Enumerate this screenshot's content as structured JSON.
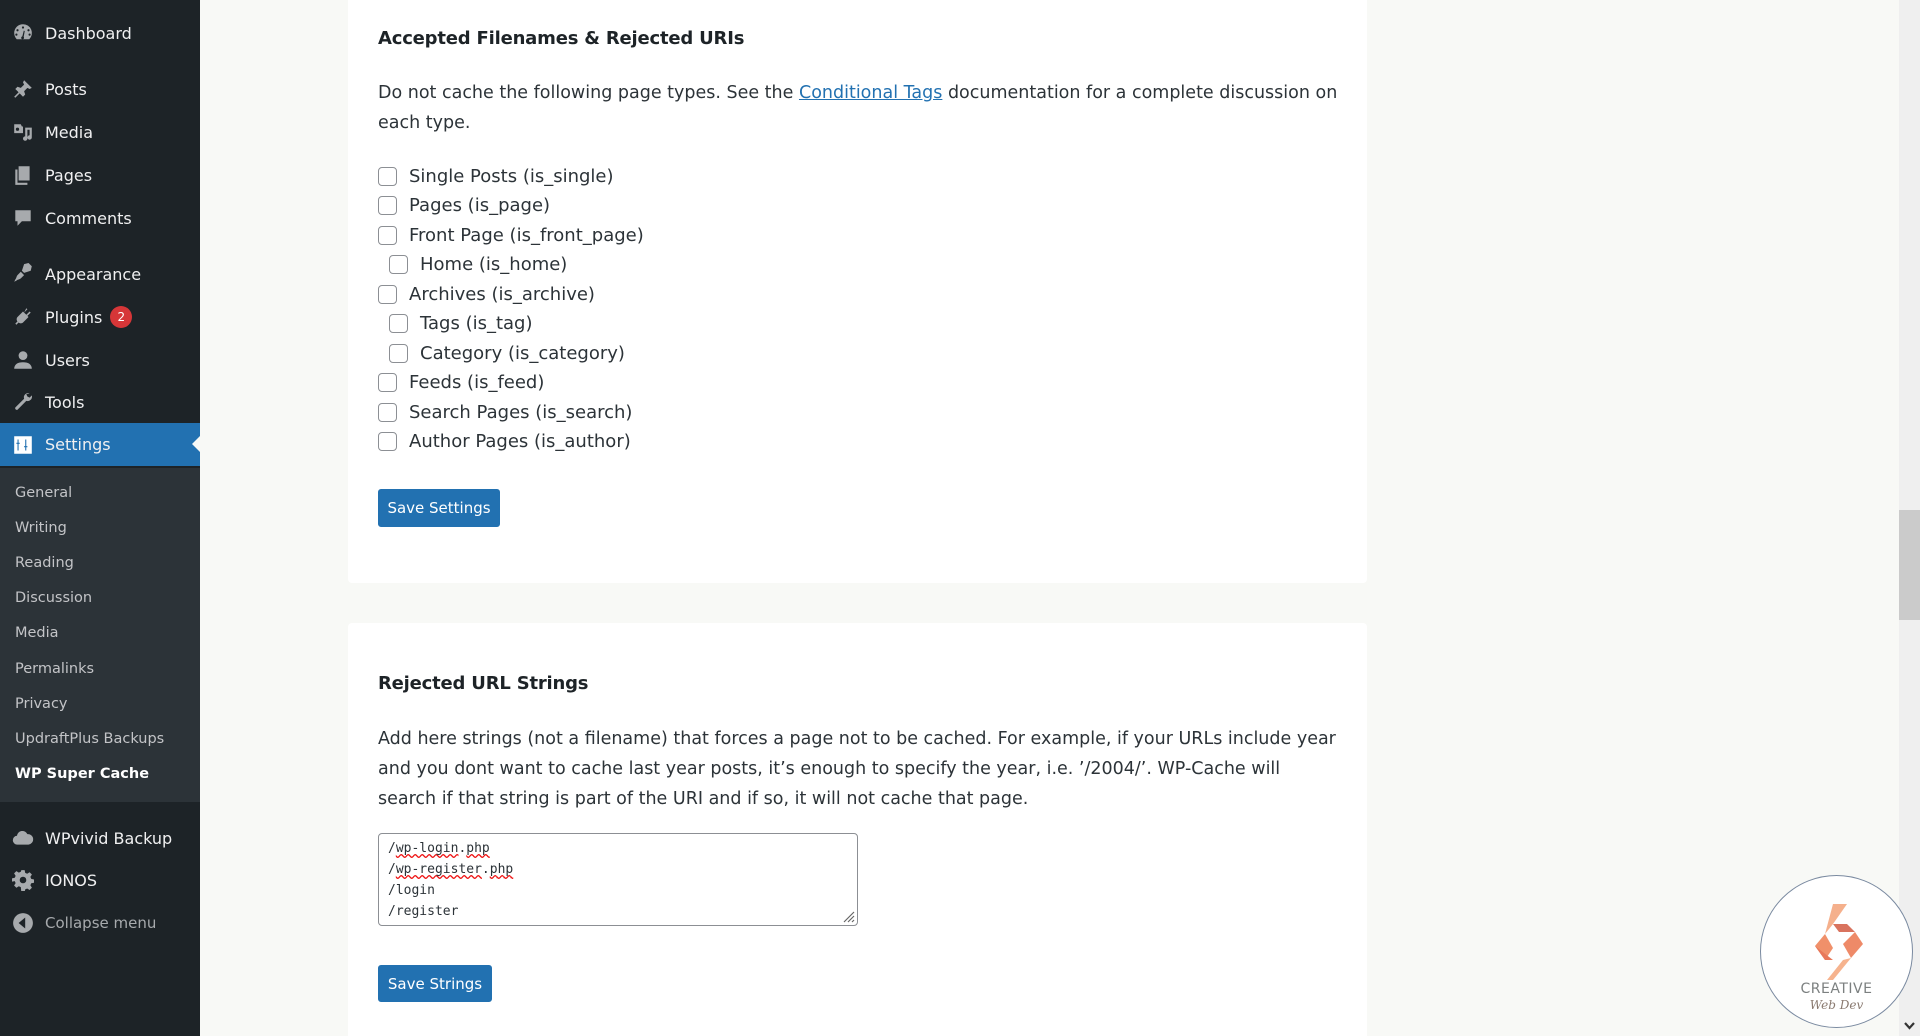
{
  "sidebar": {
    "menu": [
      {
        "label": "Dashboard",
        "icon": "dashboard-icon"
      },
      {
        "label": "Posts",
        "icon": "pin-icon"
      },
      {
        "label": "Media",
        "icon": "media-icon"
      },
      {
        "label": "Pages",
        "icon": "pages-icon"
      },
      {
        "label": "Comments",
        "icon": "comment-icon"
      },
      {
        "label": "Appearance",
        "icon": "brush-icon"
      },
      {
        "label": "Plugins",
        "icon": "plug-icon",
        "badge": "2"
      },
      {
        "label": "Users",
        "icon": "user-icon"
      },
      {
        "label": "Tools",
        "icon": "wrench-icon"
      },
      {
        "label": "Settings",
        "icon": "settings-icon",
        "active": true
      }
    ],
    "submenu": [
      "General",
      "Writing",
      "Reading",
      "Discussion",
      "Media",
      "Permalinks",
      "Privacy",
      "UpdraftPlus Backups",
      "WP Super Cache"
    ],
    "submenu_current": "WP Super Cache",
    "bottom_menu": [
      {
        "label": "WPvivid Backup",
        "icon": "cloud-icon"
      },
      {
        "label": "IONOS",
        "icon": "gear-icon"
      },
      {
        "label": "Collapse menu",
        "icon": "collapse-arrow-icon"
      }
    ]
  },
  "accepted_section": {
    "title": "Accepted Filenames & Rejected URIs",
    "desc_before": "Do not cache the following page types. See the ",
    "desc_link": "Conditional Tags",
    "desc_after": " documentation for a complete discussion on each type.",
    "checkboxes": [
      {
        "label": "Single Posts (is_single)",
        "checked": false,
        "indent": false
      },
      {
        "label": "Pages (is_page)",
        "checked": false,
        "indent": false
      },
      {
        "label": "Front Page (is_front_page)",
        "checked": false,
        "indent": false
      },
      {
        "label": "Home (is_home)",
        "checked": false,
        "indent": true
      },
      {
        "label": "Archives (is_archive)",
        "checked": false,
        "indent": false
      },
      {
        "label": "Tags (is_tag)",
        "checked": false,
        "indent": true
      },
      {
        "label": "Category (is_category)",
        "checked": false,
        "indent": true
      },
      {
        "label": "Feeds (is_feed)",
        "checked": false,
        "indent": false
      },
      {
        "label": "Search Pages (is_search)",
        "checked": false,
        "indent": false
      },
      {
        "label": "Author Pages (is_author)",
        "checked": false,
        "indent": false
      }
    ],
    "save_label": "Save Settings"
  },
  "rejected_section": {
    "title": "Rejected URL Strings",
    "desc": "Add here strings (not a filename) that forces a page not to be cached. For example, if your URLs include year and you dont want to cache last year posts, it’s enough to specify the year, i.e. ’/2004/’. WP-Cache will search if that string is part of the URI and if so, it will not cache that page.",
    "textarea_lines": [
      "/wp-login.php",
      "/wp-register.php",
      "/login",
      "/register"
    ],
    "save_label": "Save Strings"
  },
  "logo": {
    "line1": "CREATIVE",
    "line2": "Web Dev"
  },
  "colors": {
    "accent": "#2271b1",
    "sidebar_bg": "#1d2327",
    "submenu_bg": "#2c3338",
    "badge": "#d63638"
  }
}
